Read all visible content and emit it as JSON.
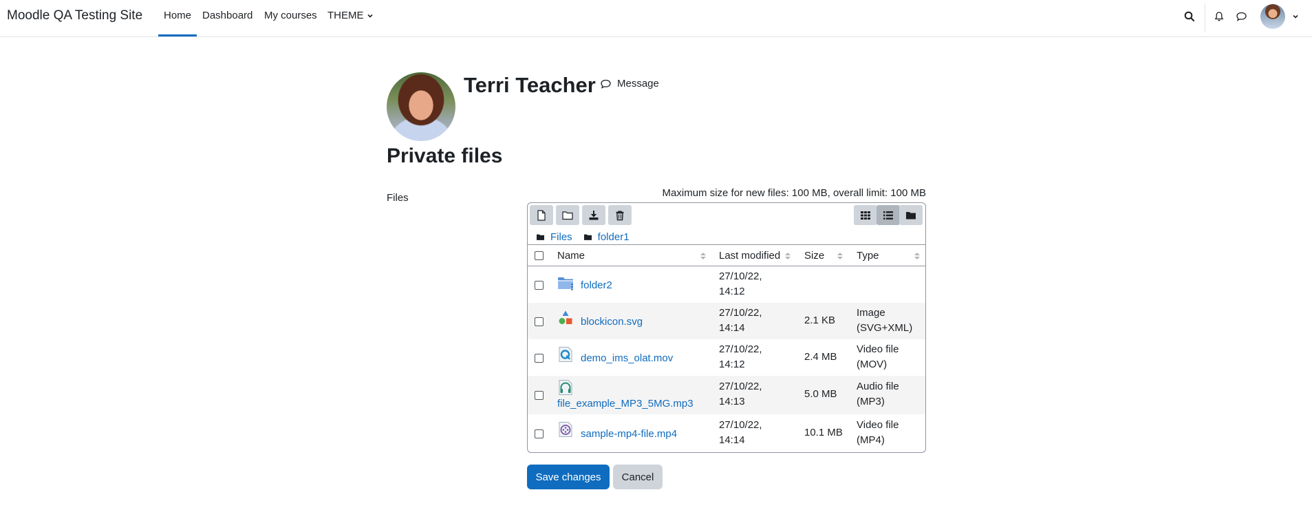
{
  "navbar": {
    "brand": "Moodle QA Testing Site",
    "items": [
      {
        "label": "Home",
        "active": true
      },
      {
        "label": "Dashboard"
      },
      {
        "label": "My courses"
      },
      {
        "label": "THEME"
      }
    ],
    "icons": [
      "search-icon",
      "bell-icon",
      "chat-icon",
      "avatar",
      "chevron-down-icon"
    ]
  },
  "profile": {
    "name": "Terri Teacher",
    "message_label": "Message"
  },
  "page": {
    "title": "Private files",
    "files_label": "Files",
    "max_size": "Maximum size for new files: 100 MB, overall limit: 100 MB"
  },
  "filemanager": {
    "toolbar": [
      "add-file-icon",
      "create-folder-icon",
      "download-icon",
      "delete-icon"
    ],
    "views": [
      "icons-view-icon",
      "list-view-icon",
      "tree-view-icon"
    ],
    "active_view": "list",
    "breadcrumb": [
      "Files",
      "folder1"
    ],
    "columns": {
      "name": "Name",
      "modified": "Last modified",
      "size": "Size",
      "type": "Type"
    },
    "rows": [
      {
        "name": "folder2",
        "modified_1": "27/10/22,",
        "modified_2": "14:12",
        "size": "",
        "type_1": "",
        "type_2": "",
        "icon": "folder-icon"
      },
      {
        "name": "blockicon.svg",
        "modified_1": "27/10/22,",
        "modified_2": "14:14",
        "size": "2.1 KB",
        "type_1": "Image",
        "type_2": "(SVG+XML)",
        "icon": "image-shapes-icon"
      },
      {
        "name": "demo_ims_olat.mov",
        "modified_1": "27/10/22,",
        "modified_2": "14:12",
        "size": "2.4 MB",
        "type_1": "Video file",
        "type_2": "(MOV)",
        "icon": "quicktime-icon"
      },
      {
        "name": "file_example_MP3_5MG.mp3",
        "modified_1": "27/10/22,",
        "modified_2": "14:13",
        "size": "5.0 MB",
        "type_1": "Audio file",
        "type_2": "(MP3)",
        "icon": "headphones-icon"
      },
      {
        "name": "sample-mp4-file.mp4",
        "modified_1": "27/10/22,",
        "modified_2": "14:14",
        "size": "10.1 MB",
        "type_1": "Video file",
        "type_2": "(MP4)",
        "icon": "video-reel-icon"
      }
    ]
  },
  "actions": {
    "save": "Save changes",
    "cancel": "Cancel"
  },
  "colors": {
    "primary": "#0f6cbf",
    "secondary": "#ced4da",
    "border": "#8f959e"
  }
}
